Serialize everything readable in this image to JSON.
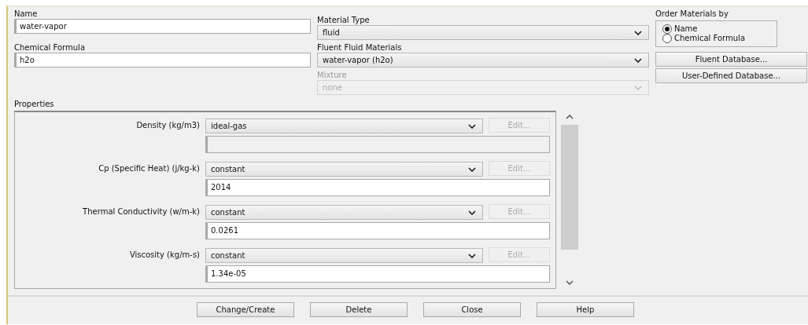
{
  "name_field": {
    "label": "Name",
    "value": "water-vapor"
  },
  "formula_field": {
    "label": "Chemical Formula",
    "value": "h2o"
  },
  "selects": [
    {
      "label": "Material Type",
      "value": "fluid",
      "disabled": false
    },
    {
      "label": "Fluent Fluid Materials",
      "value": "water-vapor (h2o)",
      "disabled": false
    },
    {
      "label": "Mixture",
      "value": "none",
      "disabled": true
    }
  ],
  "order_by": {
    "label": "Order Materials by",
    "options": [
      {
        "label": "Name",
        "selected": true
      },
      {
        "label": "Chemical Formula",
        "selected": false
      }
    ]
  },
  "database_buttons": [
    "Fluent Database...",
    "User-Defined Database..."
  ],
  "properties": {
    "label": "Properties",
    "rows": [
      {
        "label": "Density (kg/m3)",
        "method": "ideal-gas",
        "edit": {
          "label": "Edit...",
          "disabled": true
        },
        "field_disabled": true
      },
      {
        "label": "Cp (Specific Heat) (j/kg-k)",
        "method": "constant",
        "edit": {
          "label": "Edit...",
          "disabled": true
        },
        "value": "2014",
        "field_disabled": false
      },
      {
        "label": "Thermal Conductivity (w/m-k)",
        "method": "constant",
        "edit": {
          "label": "Edit...",
          "disabled": true
        },
        "value": "0.0261",
        "field_disabled": false
      },
      {
        "label": "Viscosity (kg/m-s)",
        "method": "constant",
        "edit": {
          "label": "Edit...",
          "disabled": true
        },
        "value": "1.34e-05",
        "field_disabled": false
      }
    ]
  },
  "buttons": [
    "Change/Create",
    "Delete",
    "Close",
    "Help"
  ]
}
